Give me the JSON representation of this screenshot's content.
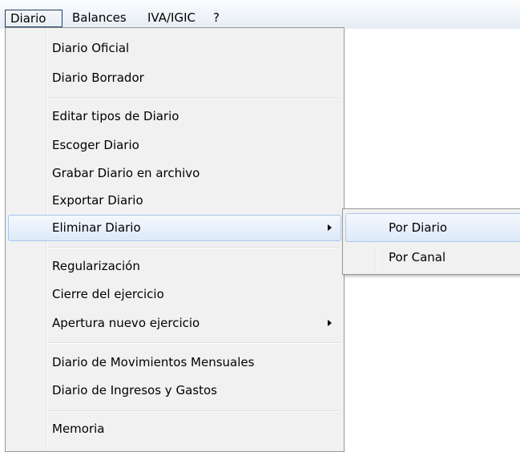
{
  "menubar": {
    "items": [
      "Diario",
      "Balances",
      "IVA/IGIC",
      "?"
    ]
  },
  "diario_menu": {
    "items": [
      "Diario Oficial",
      "Diario Borrador",
      "Editar tipos de Diario",
      "Escoger Diario",
      "Grabar Diario en archivo",
      "Exportar Diario",
      "Eliminar Diario",
      "Regularización",
      "Cierre del ejercicio",
      "Apertura nuevo ejercicio",
      "Diario de Movimientos Mensuales",
      "Diario de Ingresos y Gastos",
      "Memoria"
    ],
    "highlighted": "Eliminar Diario",
    "submenu_arrow_icon": "chevron-right-icon"
  },
  "eliminar_submenu": {
    "items": [
      "Por Diario",
      "Por Canal"
    ],
    "highlighted": "Por Diario"
  },
  "colors": {
    "menu_bg": "#f1f1f1",
    "highlight_border": "#a8c8ec",
    "highlight_bg": "#dde9f9",
    "active_menubar_border": "#1d3d66"
  }
}
